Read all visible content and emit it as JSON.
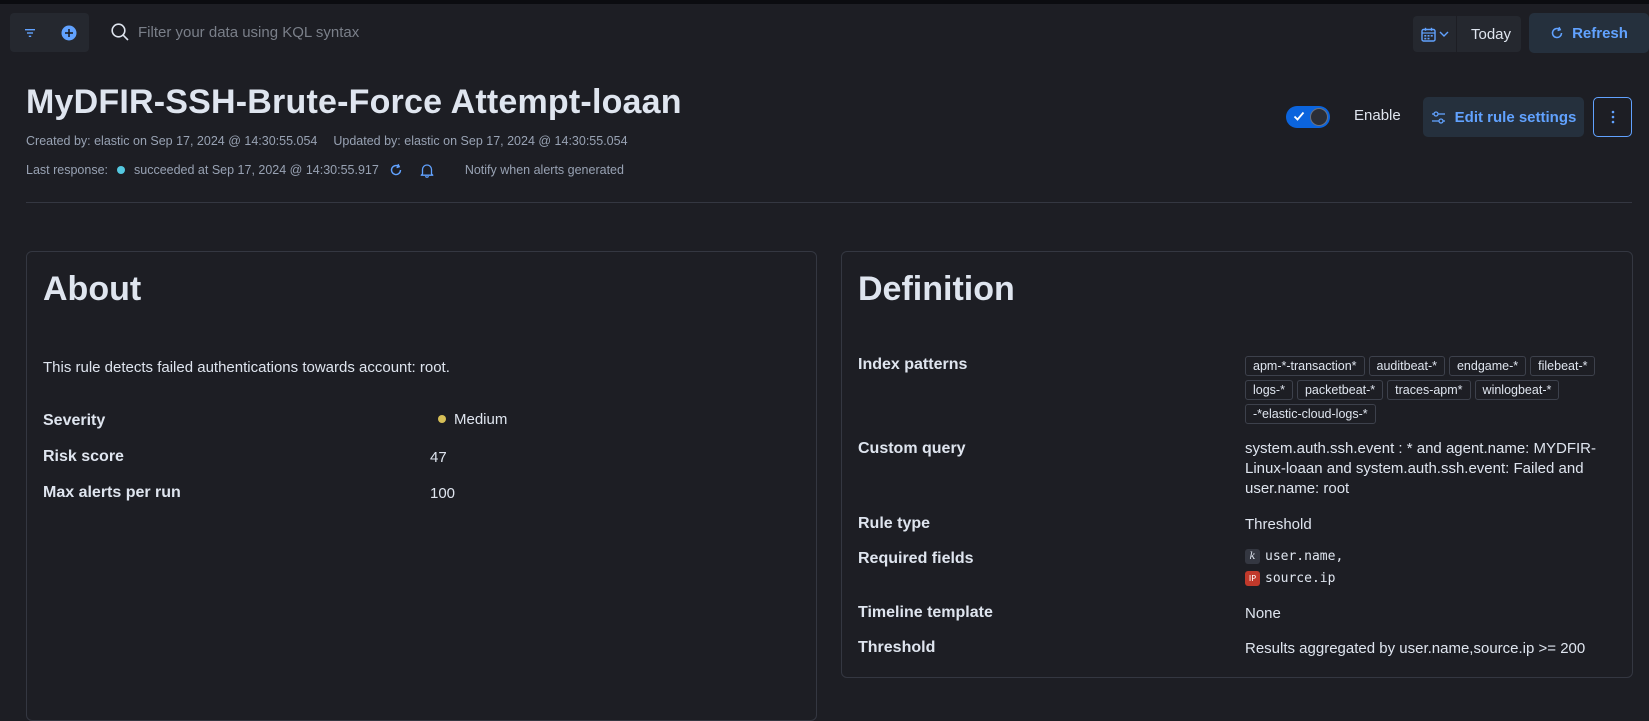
{
  "querybar": {
    "search_placeholder": "Filter your data using KQL syntax",
    "date_label": "Today",
    "refresh_label": "Refresh"
  },
  "rule": {
    "title": "MyDFIR-SSH-Brute-Force Attempt-loaan",
    "created": "Created by: elastic on Sep 17, 2024 @ 14:30:55.054",
    "updated": "Updated by: elastic on Sep 17, 2024 @ 14:30:55.054",
    "last_response_label": "Last response:",
    "last_response_status": "succeeded at Sep 17, 2024 @ 14:30:55.917",
    "notify_label": "Notify when alerts generated",
    "enable_label": "Enable",
    "enabled": true,
    "edit_label": "Edit rule settings"
  },
  "about": {
    "title": "About",
    "description": "This rule detects failed authentications towards account: root.",
    "severity_label": "Severity",
    "severity_value": "Medium",
    "severity_color": "#d6bf57",
    "risk_label": "Risk score",
    "risk_value": "47",
    "max_alerts_label": "Max alerts per run",
    "max_alerts_value": "100"
  },
  "definition": {
    "title": "Definition",
    "index_label": "Index patterns",
    "index_patterns": [
      "apm-*-transaction*",
      "auditbeat-*",
      "endgame-*",
      "filebeat-*",
      "logs-*",
      "packetbeat-*",
      "traces-apm*",
      "winlogbeat-*",
      "-*elastic-cloud-logs-*"
    ],
    "query_label": "Custom query",
    "query_value": "system.auth.ssh.event : * and agent.name: MYDFIR-Linux-loaan and system.auth.ssh.event: Failed and user.name: root",
    "rule_type_label": "Rule type",
    "rule_type_value": "Threshold",
    "required_fields_label": "Required fields",
    "required_fields": [
      "user.name,",
      "source.ip"
    ],
    "timeline_label": "Timeline template",
    "timeline_value": "None",
    "threshold_label": "Threshold",
    "threshold_value": "Results aggregated by user.name,source.ip >= 200"
  },
  "colors": {
    "accent": "#61a2ff",
    "background": "#1d1e24",
    "status_success": "#54c8e0"
  }
}
